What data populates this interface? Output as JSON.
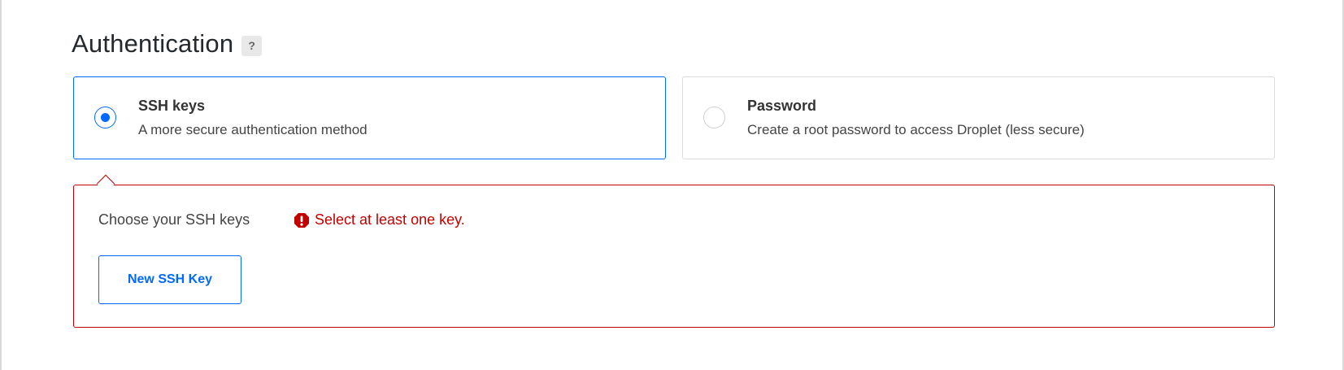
{
  "section": {
    "title": "Authentication",
    "help_icon_glyph": "?"
  },
  "options": [
    {
      "title": "SSH keys",
      "description": "A more secure authentication method",
      "selected": true
    },
    {
      "title": "Password",
      "description": "Create a root password to access Droplet (less secure)",
      "selected": false
    }
  ],
  "ssh_panel": {
    "label": "Choose your SSH keys",
    "error": "Select at least one key.",
    "new_key_button": "New SSH Key"
  },
  "colors": {
    "accent": "#0069ff",
    "error": "#c20000"
  },
  "icons": {
    "help": "question-mark-icon",
    "error": "exclamation-octagon-icon"
  }
}
